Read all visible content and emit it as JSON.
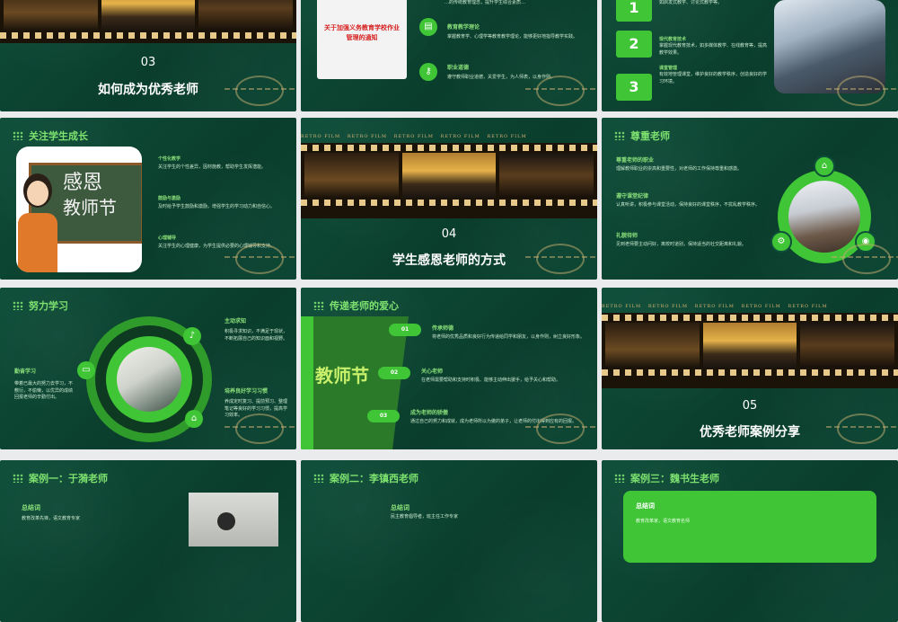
{
  "s1": {
    "num": "03",
    "title": "如何成为优秀老师"
  },
  "s2": {
    "notice": "关于加强义务教育学校作业管理的通知",
    "top_text": "…的传统教育理念，提升学生综合素质…",
    "items": [
      {
        "title": "教育教学理论",
        "desc": "掌握教育学、心理学等教育教学理论，能够更好地指导教学实践。"
      },
      {
        "title": "职业道德",
        "desc": "遵守教师职业道德，关爱学生，为人师表，以身作则。"
      }
    ]
  },
  "s3": {
    "top_text": "如启发式教学、讨论式教学等。",
    "items": [
      {
        "num": "1"
      },
      {
        "num": "2",
        "title": "现代教育技术",
        "desc": "掌握现代教育技术，如多媒体教学、在线教育等，提高教学效果。"
      },
      {
        "num": "3",
        "title": "课堂管理",
        "desc": "有效地管理课堂，维护良好的教学秩序，创造良好的学习环境。"
      }
    ]
  },
  "s4": {
    "header": "关注学生成长",
    "board_text_1": "感恩",
    "board_text_2": "教师节",
    "items": [
      {
        "title": "个性化教学",
        "desc": "关注学生的个性差异，因材施教，帮助学生发挥潜能。"
      },
      {
        "title": "鼓励与激励",
        "desc": "及时给予学生鼓励和激励，增强学生的学习动力和自信心。"
      },
      {
        "title": "心理辅导",
        "desc": "关注学生的心理健康，为学生提供必要的心理辅导和支持。"
      }
    ]
  },
  "s5": {
    "retro": "RETRO FILM",
    "num": "04",
    "title": "学生感恩老师的方式"
  },
  "s6": {
    "header": "尊重老师",
    "items": [
      {
        "title": "尊重老师的职业",
        "desc": "理解教师职业的崇高和重要性，对老师的工作保持尊重和感激。"
      },
      {
        "title": "遵守课堂纪律",
        "desc": "认真听讲，积极参与课堂活动，保持良好的课堂秩序，不扰乱教学秩序。"
      },
      {
        "title": "礼貌待师",
        "desc": "见到老师要主动问好，离校时道别，保持适当的社交距离和礼貌。"
      }
    ]
  },
  "s7": {
    "header": "努力学习",
    "items": [
      {
        "title": "主动求知",
        "desc": "积极寻求知识，不满足于现状，不断拓展自己的知识面和视野。"
      },
      {
        "title": "勤奋学习",
        "desc": "带着已最大的努力去学习，不敷衍，不偷懒，以优异的成绩回报老师的辛勤付出。"
      },
      {
        "title": "培养良好学习习惯",
        "desc": "养成定时复习、提前预习、整理笔记等良好的学习习惯，提高学习效率。"
      }
    ]
  },
  "s8": {
    "header": "传递老师的爱心",
    "board_text": "教师节",
    "items": [
      {
        "num": "01",
        "title": "传承师德",
        "desc": "将老师的优秀品质和良好行为传递给同学和朋友，以身作则，树立良好形象。"
      },
      {
        "num": "02",
        "title": "关心老师",
        "desc": "在老师需要帮助和支持时积极、能够主动伸出援手，给予关心和帮助。"
      },
      {
        "num": "03",
        "title": "成为老师的骄傲",
        "desc": "通过自己的努力和成就，成为老师所以为傲的弟子，让老师的付出得到应有的回报。"
      }
    ]
  },
  "s9": {
    "retro": "RETRO FILM",
    "num": "05",
    "title": "优秀老师案例分享"
  },
  "s10": {
    "header": "案例一：于漪老师",
    "sub": "总结词",
    "desc": "教育改革先锋，语文教育专家"
  },
  "s11": {
    "header": "案例二：李镇西老师",
    "sub": "总结词",
    "desc": "民主教育倡导者，班主任工作专家"
  },
  "s12": {
    "header": "案例三：魏书生老师",
    "sub": "总结词",
    "desc": "教育改革家，语文教育名师"
  },
  "colors": {
    "bg": "#0f4f3a",
    "accent": "#3fc535",
    "label": "#8be07a"
  }
}
